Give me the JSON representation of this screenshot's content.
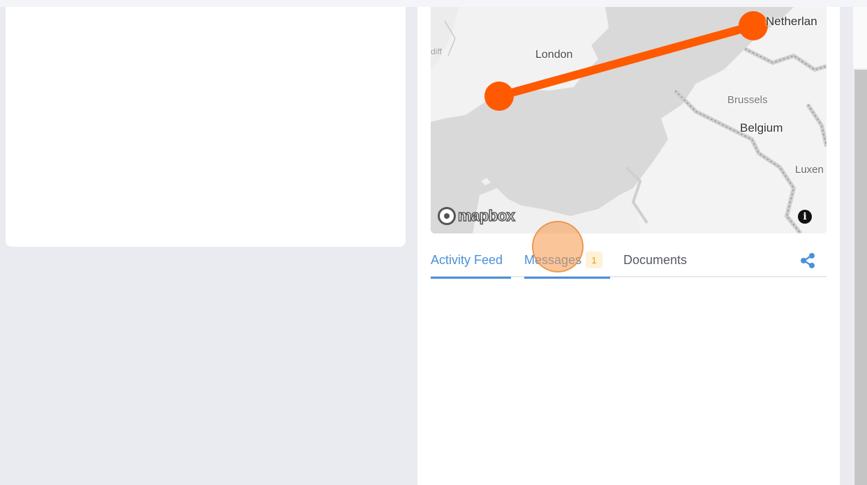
{
  "map": {
    "labels": {
      "london": "London",
      "brussels": "Brussels",
      "belgium": "Belgium",
      "luxembourg": "Luxen",
      "netherlands": "Netherlan",
      "cardiff": "diff"
    },
    "attribution": "mapbox",
    "info_icon": "i",
    "route_color": "#ff5a00"
  },
  "tabs": {
    "activity_feed": "Activity Feed",
    "messages": "Messages",
    "messages_badge": "1",
    "documents": "Documents"
  },
  "icons": {
    "share": "share-icon",
    "info": "info-icon",
    "mapbox": "mapbox-logo-icon"
  },
  "colors": {
    "accent": "#4a90d9",
    "badge_bg": "#fdf1d6",
    "badge_text": "#e0a000",
    "route": "#ff5a00"
  }
}
